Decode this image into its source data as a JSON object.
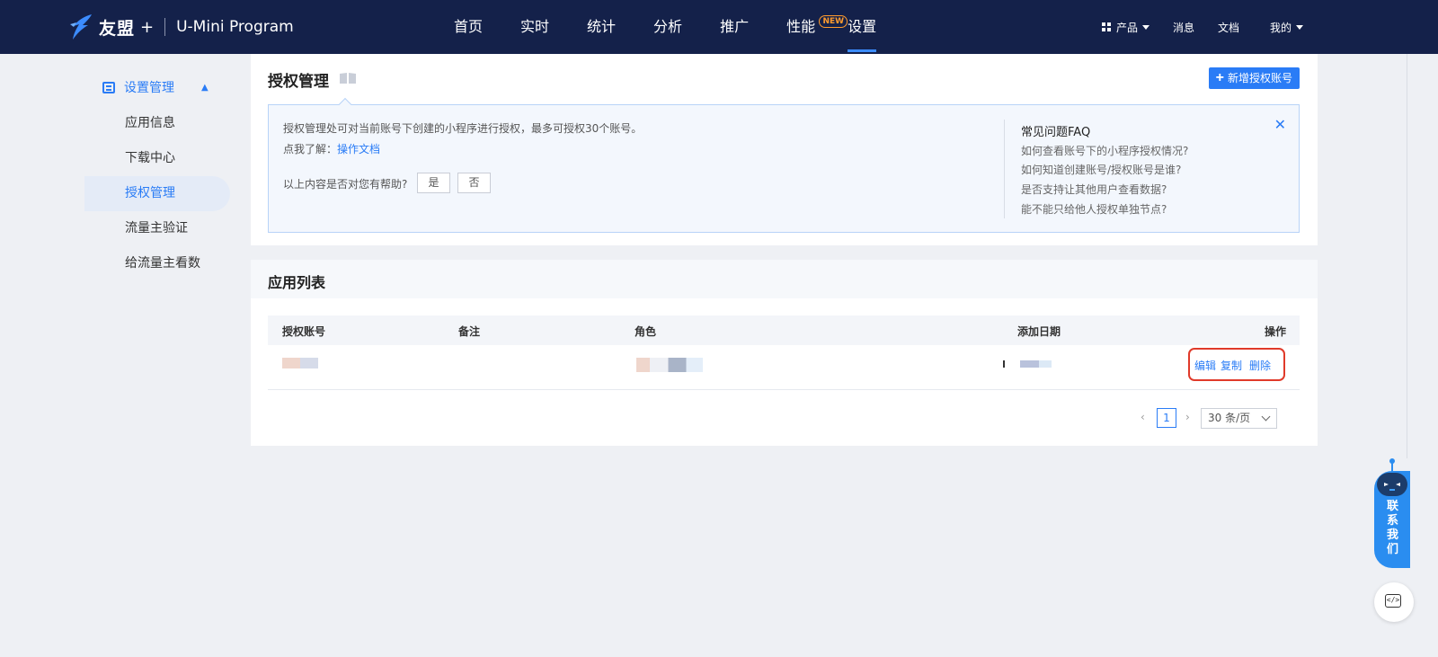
{
  "header": {
    "brand_cn": "友盟",
    "brand_plus": "+",
    "brand_product": "U-Mini Program",
    "nav": [
      {
        "label": "首页"
      },
      {
        "label": "实时"
      },
      {
        "label": "统计"
      },
      {
        "label": "分析"
      },
      {
        "label": "推广"
      },
      {
        "label": "性能",
        "badge": "NEW"
      },
      {
        "label": "设置"
      }
    ],
    "active_nav": "设置",
    "right": {
      "products": "产品",
      "messages": "消息",
      "docs": "文档",
      "mine": "我的"
    }
  },
  "sidebar": {
    "section": "设置管理",
    "items": [
      {
        "label": "应用信息"
      },
      {
        "label": "下载中心"
      },
      {
        "label": "授权管理"
      },
      {
        "label": "流量主验证"
      },
      {
        "label": "给流量主看数"
      }
    ],
    "active_item": "授权管理"
  },
  "auth": {
    "title": "授权管理",
    "add_button": "新增授权账号",
    "help": {
      "line1": "授权管理处可对当前账号下创建的小程序进行授权，最多可授权30个账号。",
      "line2_prefix": "点我了解：",
      "line2_link": "操作文档",
      "ask": "以上内容是否对您有帮助?",
      "yes": "是",
      "no": "否"
    },
    "faq": {
      "title": "常见问题FAQ",
      "items": [
        "如何查看账号下的小程序授权情况?",
        "如何知道创建账号/授权账号是谁?",
        "是否支持让其他用户查看数据?",
        "能不能只给他人授权单独节点?"
      ]
    }
  },
  "app_list": {
    "title": "应用列表",
    "columns": [
      "授权账号",
      "备注",
      "角色",
      "添加日期",
      "操作"
    ],
    "row_actions": [
      "编辑",
      "复制",
      "删除"
    ],
    "pagination": {
      "current_page": "1",
      "page_size": "30 条/页"
    }
  },
  "widget": {
    "contact": "联系我们"
  },
  "colors": {
    "header_bg": "#14214a",
    "accent": "#2a7cf6",
    "highlight_border": "#e03a2a",
    "new_badge": "#ff9b2e"
  }
}
